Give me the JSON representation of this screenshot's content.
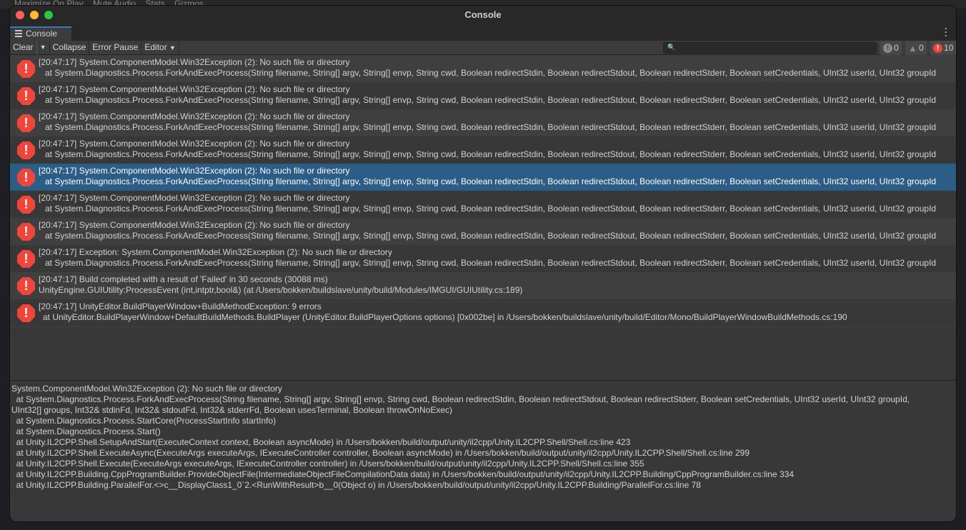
{
  "background_toolbar": [
    "Maximize On Play",
    "Mute Audio",
    "Stats",
    "Gizmos"
  ],
  "window": {
    "title": "Console"
  },
  "tab": {
    "label": "Console"
  },
  "toolbar": {
    "clear": "Clear",
    "collapse": "Collapse",
    "error_pause": "Error Pause",
    "editor": "Editor",
    "search_placeholder": "",
    "info_count": "0",
    "warning_count": "0",
    "error_count": "10"
  },
  "colors": {
    "error": "#f0453b",
    "selected": "#2c5d87",
    "tab_accent": "#3a79bb"
  },
  "entries": [
    {
      "line1": "[20:47:17] System.ComponentModel.Win32Exception (2): No such file or directory",
      "line2": "at System.Diagnostics.Process.ForkAndExecProcess(String filename, String[] argv, String[] envp, String cwd, Boolean redirectStdin, Boolean redirectStdout, Boolean redirectStderr, Boolean setCredentials, UInt32 userId, UInt32 groupId"
    },
    {
      "line1": "[20:47:17] System.ComponentModel.Win32Exception (2): No such file or directory",
      "line2": "at System.Diagnostics.Process.ForkAndExecProcess(String filename, String[] argv, String[] envp, String cwd, Boolean redirectStdin, Boolean redirectStdout, Boolean redirectStderr, Boolean setCredentials, UInt32 userId, UInt32 groupId"
    },
    {
      "line1": "[20:47:17] System.ComponentModel.Win32Exception (2): No such file or directory",
      "line2": "at System.Diagnostics.Process.ForkAndExecProcess(String filename, String[] argv, String[] envp, String cwd, Boolean redirectStdin, Boolean redirectStdout, Boolean redirectStderr, Boolean setCredentials, UInt32 userId, UInt32 groupId"
    },
    {
      "line1": "[20:47:17] System.ComponentModel.Win32Exception (2): No such file or directory",
      "line2": "at System.Diagnostics.Process.ForkAndExecProcess(String filename, String[] argv, String[] envp, String cwd, Boolean redirectStdin, Boolean redirectStdout, Boolean redirectStderr, Boolean setCredentials, UInt32 userId, UInt32 groupId"
    },
    {
      "line1": "[20:47:17] System.ComponentModel.Win32Exception (2): No such file or directory",
      "line2": "at System.Diagnostics.Process.ForkAndExecProcess(String filename, String[] argv, String[] envp, String cwd, Boolean redirectStdin, Boolean redirectStdout, Boolean redirectStderr, Boolean setCredentials, UInt32 userId, UInt32 groupId"
    },
    {
      "line1": "[20:47:17] System.ComponentModel.Win32Exception (2): No such file or directory",
      "line2": "at System.Diagnostics.Process.ForkAndExecProcess(String filename, String[] argv, String[] envp, String cwd, Boolean redirectStdin, Boolean redirectStdout, Boolean redirectStderr, Boolean setCredentials, UInt32 userId, UInt32 groupId"
    },
    {
      "line1": "[20:47:17] System.ComponentModel.Win32Exception (2): No such file or directory",
      "line2": "at System.Diagnostics.Process.ForkAndExecProcess(String filename, String[] argv, String[] envp, String cwd, Boolean redirectStdin, Boolean redirectStdout, Boolean redirectStderr, Boolean setCredentials, UInt32 userId, UInt32 groupId"
    },
    {
      "line1": "[20:47:17] Exception: System.ComponentModel.Win32Exception (2): No such file or directory",
      "line2": "at System.Diagnostics.Process.ForkAndExecProcess(String filename, String[] argv, String[] envp, String cwd, Boolean redirectStdin, Boolean redirectStdout, Boolean redirectStderr, Boolean setCredentials, UInt32 userId, UInt32 groupId"
    },
    {
      "line1": "[20:47:17] Build completed with a result of 'Failed' in 30 seconds (30088 ms)",
      "line2": "UnityEngine.GUIUtility:ProcessEvent (int,intptr,bool&) (at /Users/bokken/buildslave/unity/build/Modules/IMGUI/GUIUtility.cs:189)"
    },
    {
      "line1": "[20:47:17] UnityEditor.BuildPlayerWindow+BuildMethodException: 9 errors",
      "line2": "at UnityEditor.BuildPlayerWindow+DefaultBuildMethods.BuildPlayer (UnityEditor.BuildPlayerOptions options) [0x002be] in /Users/bokken/buildslave/unity/build/Editor/Mono/BuildPlayerWindowBuildMethods.cs:190"
    }
  ],
  "detail": [
    "System.ComponentModel.Win32Exception (2): No such file or directory",
    "  at System.Diagnostics.Process.ForkAndExecProcess(String filename, String[] argv, String[] envp, String cwd, Boolean redirectStdin, Boolean redirectStdout, Boolean redirectStderr, Boolean setCredentials, UInt32 userId, UInt32 groupId,",
    "UInt32[] groups, Int32& stdinFd, Int32& stdoutFd, Int32& stderrFd, Boolean usesTerminal, Boolean throwOnNoExec)",
    "  at System.Diagnostics.Process.StartCore(ProcessStartInfo startInfo)",
    "  at System.Diagnostics.Process.Start()",
    "  at Unity.IL2CPP.Shell.SetupAndStart(ExecuteContext context, Boolean asyncMode) in /Users/bokken/build/output/unity/il2cpp/Unity.IL2CPP.Shell/Shell.cs:line 423",
    "  at Unity.IL2CPP.Shell.ExecuteAsync(ExecuteArgs executeArgs, IExecuteController controller, Boolean asyncMode) in /Users/bokken/build/output/unity/il2cpp/Unity.IL2CPP.Shell/Shell.cs:line 299",
    "  at Unity.IL2CPP.Shell.Execute(ExecuteArgs executeArgs, IExecuteController controller) in /Users/bokken/build/output/unity/il2cpp/Unity.IL2CPP.Shell/Shell.cs:line 355",
    "  at Unity.IL2CPP.Building.CppProgramBuilder.ProvideObjectFile(IntermediateObjectFileCompilationData data) in /Users/bokken/build/output/unity/il2cpp/Unity.IL2CPP.Building/CppProgramBuilder.cs:line 334",
    "  at Unity.IL2CPP.Building.ParallelFor.<>c__DisplayClass1_0`2.<RunWithResult>b__0(Object o) in /Users/bokken/build/output/unity/il2cpp/Unity.IL2CPP.Building/ParallelFor.cs:line 78"
  ]
}
